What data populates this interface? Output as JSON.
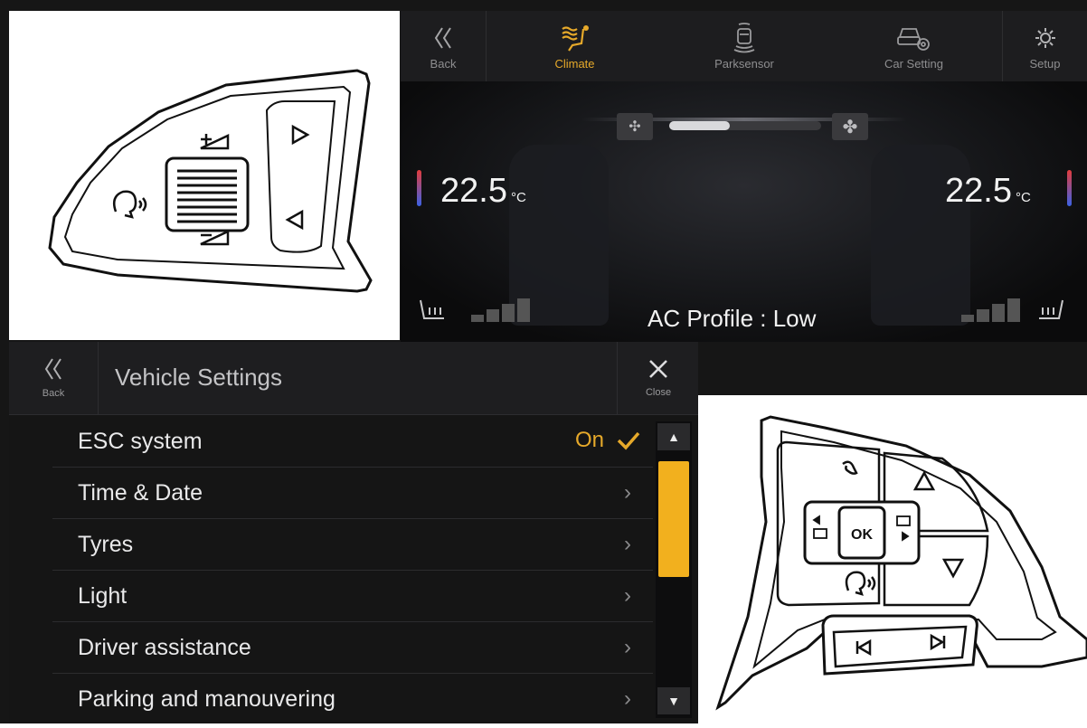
{
  "climate": {
    "nav": [
      {
        "label": "Back",
        "icon": "double-chevron-left-icon"
      },
      {
        "label": "Climate",
        "icon": "climate-seat-icon"
      },
      {
        "label": "Parksensor",
        "icon": "parksensor-icon"
      },
      {
        "label": "Car Setting",
        "icon": "car-gear-icon"
      },
      {
        "label": "Setup",
        "icon": "gear-icon"
      }
    ],
    "fan_level": 0.4,
    "left_temp": "22.5",
    "right_temp": "22.5",
    "temp_unit": "°C",
    "ac_profile": "AC Profile : Low",
    "left_seat_heat_level": 0,
    "right_seat_heat_level": 0
  },
  "settings": {
    "back_label": "Back",
    "title": "Vehicle Settings",
    "close_label": "Close",
    "esc_status": "On",
    "items": [
      {
        "label": "ESC system"
      },
      {
        "label": "Time & Date"
      },
      {
        "label": "Tyres"
      },
      {
        "label": "Light"
      },
      {
        "label": "Driver assistance"
      },
      {
        "label": "Parking and manouvering"
      }
    ]
  },
  "controls_right": {
    "ok_label": "OK"
  },
  "colors": {
    "accent": "#e6a92a",
    "scroll_thumb": "#f2b01e"
  }
}
